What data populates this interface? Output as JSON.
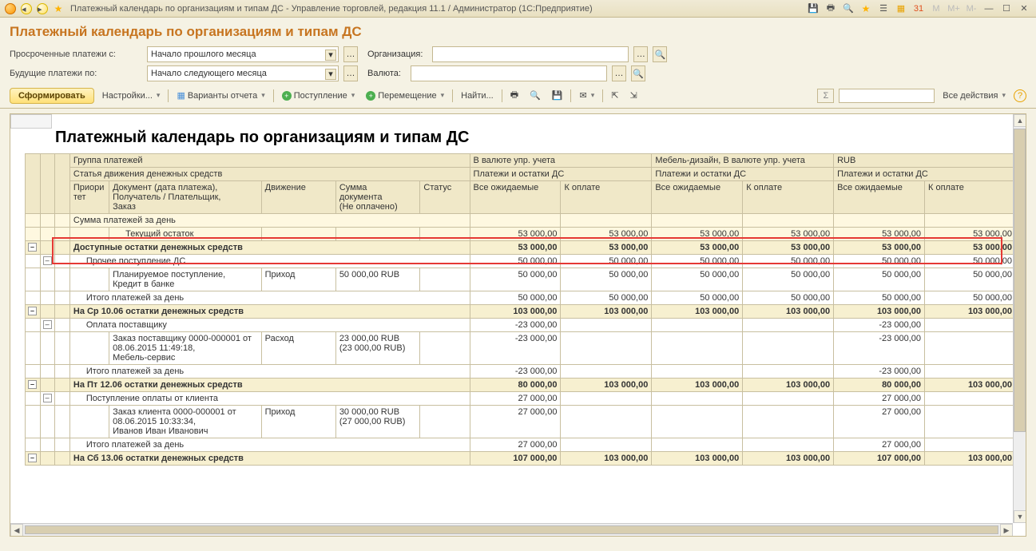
{
  "window": {
    "title": "Платежный календарь по организациям и типам ДС - Управление торговлей, редакция 11.1 / Администратор  (1С:Предприятие)"
  },
  "page_title": "Платежный календарь по организациям и типам ДС",
  "filters": {
    "overdue_label": "Просроченные платежи с:",
    "overdue_value": "Начало прошлого месяца",
    "org_label": "Организация:",
    "future_label": "Будущие платежи по:",
    "future_value": "Начало следующего месяца",
    "currency_label": "Валюта:"
  },
  "toolbar": {
    "form": "Сформировать",
    "settings": "Настройки...",
    "variants": "Варианты отчета",
    "incoming": "Поступление",
    "transfer": "Перемещение",
    "find": "Найти...",
    "all_actions": "Все действия"
  },
  "report": {
    "title": "Платежный календарь по организациям и типам ДС",
    "headers": {
      "group": "Группа платежей",
      "col_curr": "В валюте упр. учета",
      "col_org": "Мебель-дизайн, В валюте упр. учета",
      "col_rub": "RUB",
      "article": "Статья движения денежных средств",
      "balances": "Платежи и остатки ДС",
      "prio": "Приори\nтет",
      "doc": "Документ (дата платежа),\nПолучатель / Плательщик,\nЗаказ",
      "movement": "Движение",
      "sum": "Сумма\nдокумента\n(Не оплачено)",
      "status": "Статус",
      "expected": "Все ожидаемые",
      "topay": "К оплате"
    },
    "rows": {
      "day_sum": "Сумма платежей за день",
      "cur_balance": "Текущий остаток",
      "val53": "53 000,00",
      "avail": "Доступные остатки денежных средств",
      "other_inc": "Прочее поступление ДС",
      "val50": "50 000,00",
      "planned": "Планируемое поступление,\nКредит в банке",
      "in": "Приход",
      "sum50": "50 000,00 RUB",
      "day_total": "Итого платежей за день",
      "wed": "На Ср 10.06 остатки денежных средств",
      "val103": "103 000,00",
      "pay_supplier": "Оплата поставщику",
      "valm23": "-23 000,00",
      "order_sup": "Заказ поставщику 0000-000001 от 08.06.2015 11:49:18,\nМебель-сервис",
      "out": "Расход",
      "sum23": "23 000,00 RUB\n(23 000,00 RUB)",
      "fri": "На Пт 12.06 остатки денежных средств",
      "val80": "80 000,00",
      "client_pay": "Поступление оплаты от клиента",
      "val27": "27 000,00",
      "order_cli": "Заказ клиента 0000-000001 от 08.06.2015 10:33:34,\nИванов Иван Иванович",
      "sum30": "30 000,00 RUB\n(27 000,00 RUB)",
      "sat": "На Сб 13.06 остатки денежных средств",
      "val107": "107 000,00"
    }
  }
}
